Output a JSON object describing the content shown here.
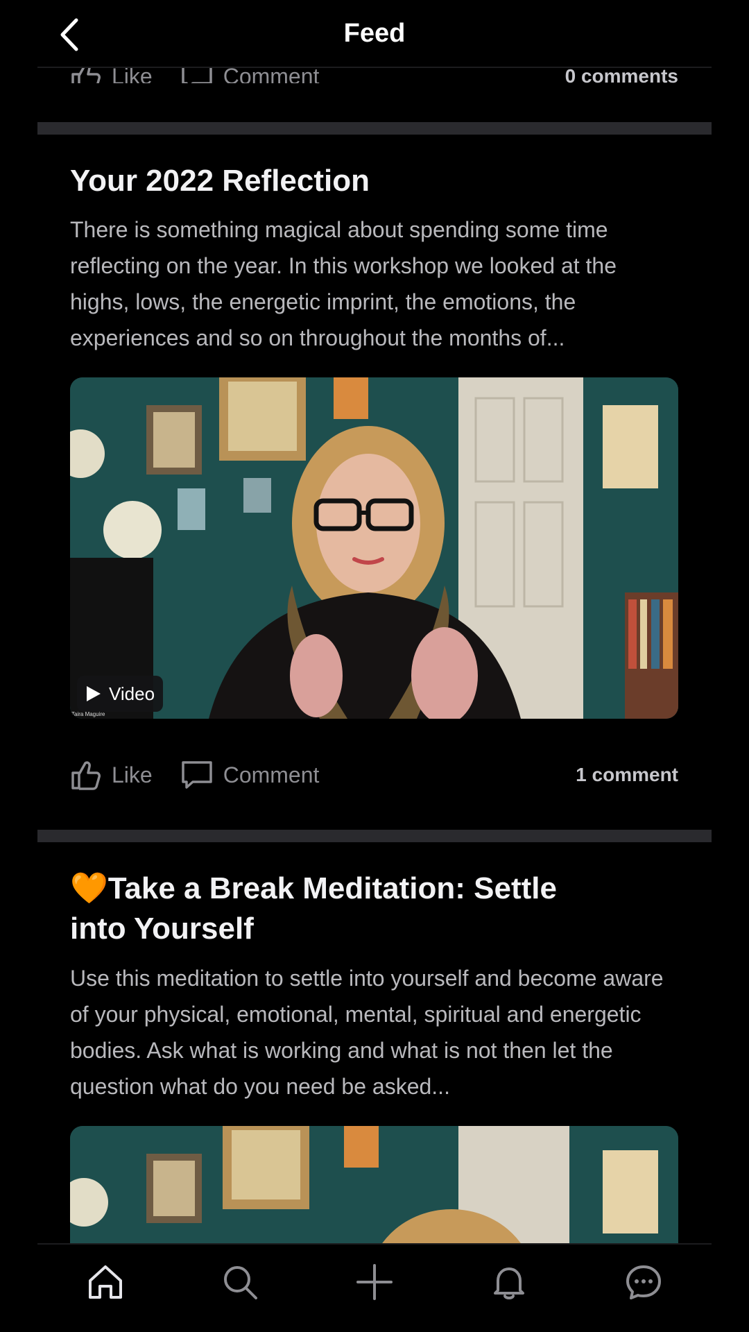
{
  "header": {
    "title": "Feed"
  },
  "previous_post": {
    "like_label": "Like",
    "comment_label": "Comment",
    "comment_count": "0 comments"
  },
  "posts": [
    {
      "title": "Your 2022 Reflection",
      "body": "There is something magical about spending some time reflecting on the year.  In this workshop we looked at the highs, lows, the energetic imprint, the emotions, the experiences and so on throughout the months of...",
      "media_badge": "Video",
      "media_credit": "Taira Maguire",
      "like_label": "Like",
      "comment_label": "Comment",
      "comment_count": "1 comment"
    },
    {
      "emoji": "🧡",
      "title": "Take a Break Meditation: Settle into Yourself",
      "body": "Use this meditation to settle into yourself and become aware of your physical, emotional, mental, spiritual and energetic bodies. Ask what is working and what is not then let the question what do you need be asked..."
    }
  ],
  "tabbar": {
    "items": [
      "home-icon",
      "search-icon",
      "plus-icon",
      "bell-icon",
      "chat-icon"
    ]
  },
  "colors": {
    "background": "#000000",
    "divider": "#2a2a2e",
    "muted_text": "#8e8e93",
    "body_text": "#b9b9bd",
    "orange_heart": "#ff8a1e"
  }
}
